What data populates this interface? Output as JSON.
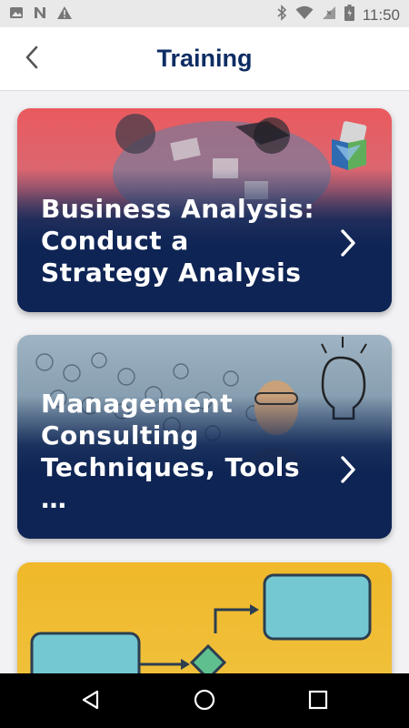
{
  "status_bar": {
    "time": "11:50"
  },
  "header": {
    "title": "Training"
  },
  "cards": [
    {
      "title": "Business Analysis: Conduct a Strategy Analysis"
    },
    {
      "title": "Management Consulting Techniques, Tools …"
    }
  ],
  "colors": {
    "title_blue": "#0d2d63",
    "card_navy": "#0e2454",
    "card3_yellow": "#f0b82a"
  }
}
